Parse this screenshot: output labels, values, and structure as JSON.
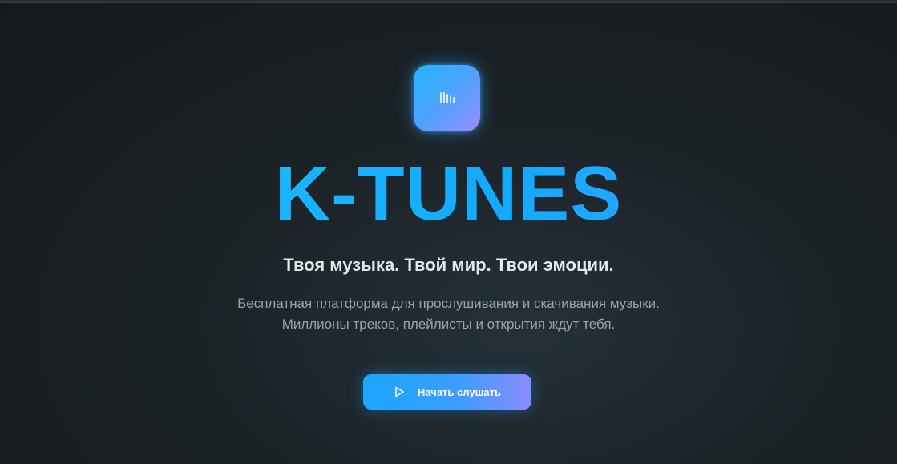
{
  "hero": {
    "logo_icon": "sound-bars-icon",
    "brand": "K-TUNES",
    "tagline": "Твоя музыка. Твой мир. Твои эмоции.",
    "description_line1": "Бесплатная платформа для прослушивания и скачивания музыки.",
    "description_line2": "Миллионы треков, плейлисты и открытия ждут тебя.",
    "cta_label": "Начать слушать",
    "cta_icon": "play-icon"
  },
  "colors": {
    "accent": "#1aa8ff",
    "accent_secondary": "#8a8cff",
    "background": "#1b2226",
    "text_primary": "#e4e8ea",
    "text_muted": "#9aa3ab"
  }
}
